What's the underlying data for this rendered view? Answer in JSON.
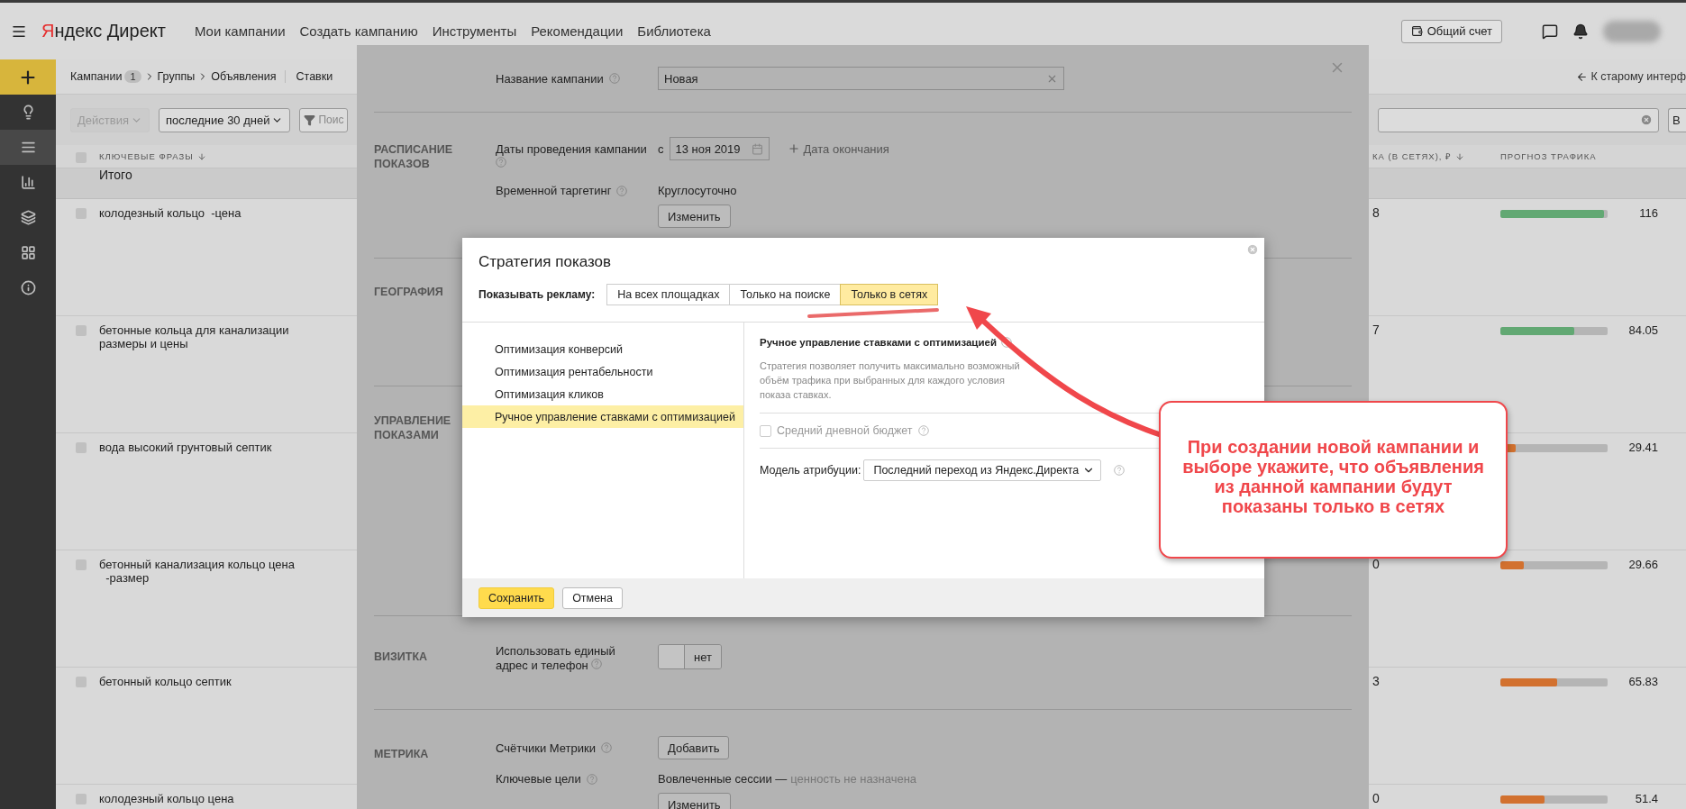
{
  "top_bar": {
    "logo": "Яндекс Директ",
    "nav": [
      "Мои кампании",
      "Создать кампанию",
      "Инструменты",
      "Рекомендации",
      "Библиотека"
    ],
    "account_button": "Общий счет"
  },
  "sidebar": {
    "items": [
      {
        "kind": "add",
        "selected": true
      },
      {
        "kind": "tips",
        "selected": false
      },
      {
        "kind": "list",
        "selected": true
      },
      {
        "kind": "stats",
        "selected": false
      },
      {
        "kind": "stack",
        "selected": false
      },
      {
        "kind": "grid",
        "selected": false
      },
      {
        "kind": "info",
        "selected": false
      }
    ]
  },
  "breadcrumbs": {
    "items": [
      {
        "label": "Кампании",
        "count": "1"
      },
      {
        "label": "Группы"
      },
      {
        "label": "Объявления"
      }
    ],
    "tab": "Ставки",
    "old_interface_link": "К старому интерф"
  },
  "toolbar": {
    "actions": {
      "label": "Действия",
      "disabled": true
    },
    "period": "последние 30 дней",
    "filter_placeholder": "Поис",
    "right_button": "В"
  },
  "table": {
    "columns": [
      "КЛЮЧЕВЫЕ ФРАЗЫ",
      "КА (В СЕТЯХ), ₽",
      "ПРОГНОЗ ТРАФИКА"
    ],
    "total_label": "Итого",
    "all_checked": false,
    "rows": [
      {
        "phrase": "колодезный кольцо  -цена",
        "checked": false,
        "bid": "8",
        "level": 0.97,
        "color": "#62a873",
        "forecast": "116"
      },
      {
        "phrase": "бетонные кольца для канализации\nразмеры и цены",
        "checked": false,
        "bid": "7",
        "level": 0.69,
        "color": "#62a873",
        "forecast": "84.05"
      },
      {
        "phrase": "вода высокий грунтовый септик",
        "checked": false,
        "level": 0.14,
        "color": "#d2712f",
        "forecast": "29.41"
      },
      {
        "phrase": "бетонный канализация кольцо цена\n  -размер",
        "checked": false,
        "bid": "0",
        "level": 0.22,
        "color": "#d2712f",
        "forecast": "29.66"
      },
      {
        "phrase": "бетонный кольцо септик",
        "checked": false,
        "bid": "3",
        "level": 0.53,
        "color": "#d2712f",
        "forecast": "65.83"
      },
      {
        "phrase": "колодезный кольцо цена",
        "checked": false,
        "bid": "0",
        "level": 0.41,
        "color": "#d2712f",
        "forecast": "51.4"
      }
    ]
  },
  "campaign_panel": {
    "name": {
      "label": "Название кампании",
      "value": "Новая"
    },
    "schedule": {
      "title": "РАСПИСАНИЕ ПОКАЗОВ",
      "dates_label": "Даты проведения кампании",
      "from_prefix": "с",
      "start_date": "13 ноя 2019",
      "end_date_link": "Дата окончания",
      "targeting_label": "Временной таргетинг",
      "targeting_value": "Круглосуточно",
      "change_button": "Изменить"
    },
    "geography": {
      "title": "ГЕОГРАФИЯ"
    },
    "display_control": {
      "title": "УПРАВЛЕНИЕ ПОКАЗАМИ"
    },
    "vcard": {
      "title": "ВИЗИТКА",
      "label": "Использовать единый адрес и телефон",
      "toggle": {
        "on": false,
        "label": "нет"
      }
    },
    "metrika": {
      "title": "МЕТРИКА",
      "counters_label": "Счётчики Метрики",
      "add_button": "Добавить",
      "goals_label": "Ключевые цели",
      "goals_value": "Вовлеченные сессии —",
      "goals_note": "ценность не назначена",
      "change_button": "Изменить"
    }
  },
  "strategy_modal": {
    "title": "Стратегия показов",
    "show_ads_label": "Показывать рекламу:",
    "placements": [
      {
        "label": "На всех площадках",
        "selected": false
      },
      {
        "label": "Только на поиске",
        "selected": false
      },
      {
        "label": "Только в сетях",
        "selected": true
      }
    ],
    "strategies": [
      {
        "label": "Оптимизация конверсий",
        "selected": false
      },
      {
        "label": "Оптимизация рентабельности",
        "selected": false
      },
      {
        "label": "Оптимизация кликов",
        "selected": false
      },
      {
        "label": "Ручное управление ставками с оптимизацией",
        "selected": true
      }
    ],
    "details": {
      "title": "Ручное управление ставками с оптимизацией",
      "description": "Стратегия позволяет получить максимально возможный объём трафика при выбранных для каждого условия показа ставках.",
      "daily_budget": {
        "label": "Средний дневной бюджет",
        "checked": false,
        "disabled": true
      },
      "attribution_label": "Модель атрибуции:",
      "attribution_value": "Последний переход из Яндекс.Директа"
    },
    "save_button": "Сохранить",
    "cancel_button": "Отмена"
  },
  "annotation": {
    "text": "При создании новой кампании и выборе укажите, что объявления из данной кампании будут показаны только в сетях"
  }
}
